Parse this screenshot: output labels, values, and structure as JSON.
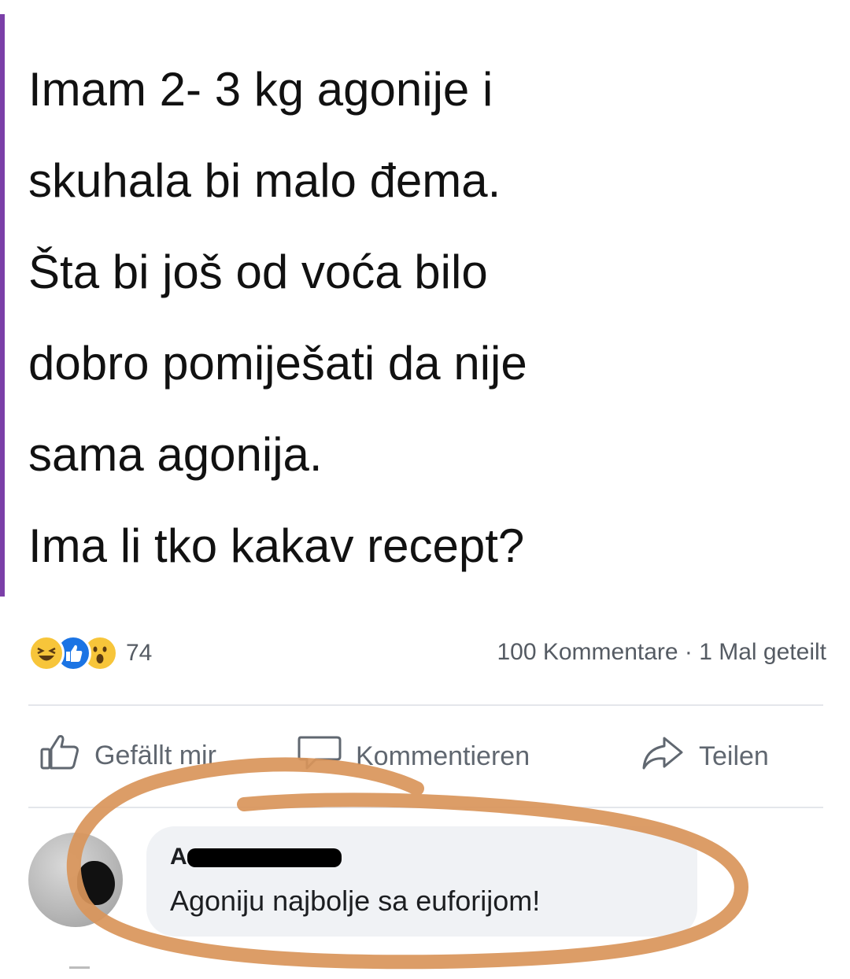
{
  "post": {
    "lines": [
      "Imam 2- 3 kg agonije i",
      "skuhala bi malo đema.",
      "Šta bi još od voća bilo",
      "dobro pomiješati da nije",
      "sama agonija.",
      "Ima li tko kakav recept?"
    ]
  },
  "stats": {
    "reaction_icons": [
      "haha-icon",
      "like-icon",
      "wow-icon"
    ],
    "reaction_count": "74",
    "comments_shares": "100 Kommentare · 1 Mal geteilt"
  },
  "actions": {
    "like_label": "Gefällt mir",
    "comment_label": "Kommentieren",
    "share_label": "Teilen"
  },
  "comment": {
    "author_initial": "A",
    "text": "Agoniju najbolje sa euforijom!"
  },
  "colors": {
    "accent": "#7b3fa8",
    "annotation": "#d9955a",
    "like_blue": "#1b74e4",
    "reaction_yellow": "#f7c53a"
  }
}
